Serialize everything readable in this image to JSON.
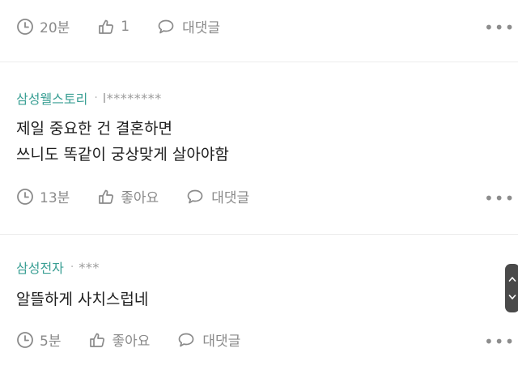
{
  "comments": [
    {
      "author": "",
      "author_masked": "",
      "body_lines": [],
      "time": "20분",
      "like_label": "1",
      "reply_label": "댓글",
      "reply_prefix": "대"
    },
    {
      "author": "삼성웰스토리",
      "author_masked": "l********",
      "body_lines": [
        "제일 중요한 건 결혼하면",
        "쓰니도 똑같이 궁상맞게 살아야함"
      ],
      "time": "13분",
      "like_label": "좋아요",
      "reply_label": "댓글",
      "reply_prefix": "대"
    },
    {
      "author": "삼성전자",
      "author_masked": "***",
      "body_lines": [
        "알뜰하게 사치스럽네"
      ],
      "time": "5분",
      "like_label": "좋아요",
      "reply_label": "댓글",
      "reply_prefix": "대"
    }
  ],
  "separator_dot": "·",
  "more_label": "•••",
  "icons": {
    "time": "clock-icon",
    "like": "thumbs-up-icon",
    "reply": "speech-bubble-icon",
    "more": "more-options-icon",
    "scroll_up": "chevron-up-icon",
    "scroll_down": "chevron-down-icon"
  },
  "colors": {
    "author": "#3a9f94",
    "meta": "#8a8a8a",
    "body": "#1e1e1e",
    "separator": "#ececec",
    "scroll_handle": "#4a4a4a"
  }
}
